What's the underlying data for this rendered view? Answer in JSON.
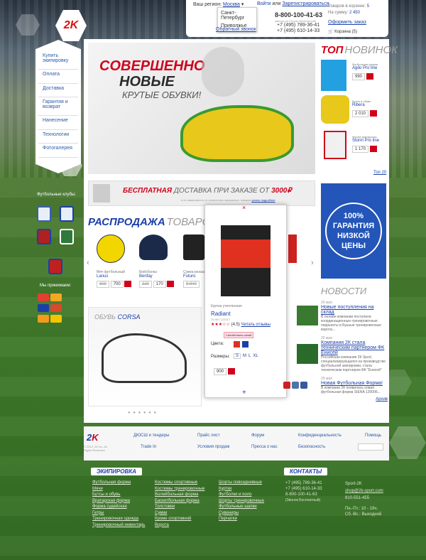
{
  "header": {
    "region_label": "Ваш регион:",
    "region_value": "Москва",
    "region_options": [
      "Санкт-Петербург",
      "Приволжье"
    ],
    "login": "Войти",
    "or": "или",
    "register": "Зарегистрироваться",
    "phone1": "8-800-100-41-63",
    "phone_note": "(звонок по России бесплатный)",
    "phone2": "+7 (495) 789-36-41",
    "phone3": "+7 (495) 610-14-33",
    "callback": "Обратный звонок",
    "cart_items_label": "Товаров в корзине:",
    "cart_items": "5",
    "cart_sum_label": "На сумму:",
    "cart_sum": "2 450",
    "checkout": "Оформить заказ",
    "cart_button": "Корзина (5)",
    "logo_text": "2K"
  },
  "nav": [
    "Купить экипировку",
    "Оплата",
    "Доставка",
    "Гарантия и возврат",
    "Нанесение",
    "Технологии",
    "Фотогалерея"
  ],
  "clubs_title": "Футбольные клубы:",
  "pay_title": "Мы принимаем:",
  "banner": {
    "line1": "СОВЕРШЕННО",
    "line2": "НОВЫЕ",
    "line3": "КРУТЫЕ ОБУВКИ!"
  },
  "delivery": {
    "strong": "БЕСПЛАТНАЯ",
    "rest": "ДОСТАВКА ПРИ ЗАКАЗЕ ОТ",
    "amount": "3000",
    "note": "и не зависимости от количества заказанных товаров",
    "link": "узнать подробнее"
  },
  "sale": {
    "title": "РАСПРОДАЖА",
    "title2": "ТОВАРОВ",
    "products": [
      {
        "cat": "Мяч футбольный",
        "name": "Lanus",
        "old": "800",
        "price": "700"
      },
      {
        "cat": "Бейсболка",
        "name": "Benfay",
        "old": "220",
        "price": "170"
      },
      {
        "cat": "Сумка-рюкзак",
        "name": "Futuro",
        "old": "9 940",
        "price": ""
      }
    ]
  },
  "popup": {
    "cat": "Куртка утепленная",
    "name": "Radiant",
    "sku": "29-987-123217",
    "rating": "(4.5)",
    "reviews": "Читать отзывы",
    "color_tip": "Синий/темно-синий",
    "colors_label": "Цвета:",
    "sizes_label": "Размеры:",
    "sizes": [
      "S",
      "M",
      "L",
      "XL"
    ],
    "price": "900"
  },
  "shoes": {
    "label": "ОБУВЬ",
    "brand": "CORSA"
  },
  "top": {
    "title": "ТОП",
    "title2": "НОВИНОК",
    "items": [
      {
        "cat": "Футбольная форма",
        "name": "Agilo Pro line",
        "price": "990"
      },
      {
        "cat": "Бутсы в обувь",
        "name": "Ribera",
        "price": "2 010"
      },
      {
        "cat": "Форма вратарская",
        "name": "Storm Pro line",
        "price": "1 170"
      }
    ],
    "link": "Топ 20"
  },
  "guarantee": {
    "line1": "100%",
    "line2": "ГАРАНТИЯ",
    "line3": "НИЗКОЙ",
    "line4": "ЦЕНЫ"
  },
  "news": {
    "title": "НОВОСТИ",
    "items": [
      {
        "date": "20 мая",
        "title": "Новые поступления на склад",
        "text": "В онлайн компании поступили координационные-тренировочные перрьекты и Буьные тренировочные ворота..."
      },
      {
        "date": "20 мая",
        "title": "Компания 2К стала техническим партнером ФК Енисей",
        "text": "Российская компания 2К Sport, специализирующаяся на производстве футбольной экипировки, стала техническим партнером ФК \"Енисей\""
      },
      {
        "date": "29 мая",
        "title": "Новая Футбольная Форма!",
        "text": "В компании 2К появилась новая футбольная форма SIENA 120006..."
      }
    ],
    "archive": "Архив"
  },
  "footer": {
    "copyright": "© 2012. 2K Inc. All Rights Reserved",
    "links": [
      "ДЮСШ и тендеры",
      "Прайс лист",
      "Форум",
      "Конфиденциальность",
      "Помощь",
      "Trade In",
      "Условия продаж",
      "Пресса о нас",
      "Безопасность"
    ]
  },
  "bottom": {
    "ekip_title": "ЭКИПИРОВКА",
    "col1": [
      "Футбольная форма",
      "Мячи",
      "Бутсы и обувь",
      "Вратарская форма",
      "Форма судейская",
      "Гетры",
      "Тренировочная одежда",
      "Тренировочный инвентарь"
    ],
    "col2": [
      "Костюмы спортивные",
      "Костюмы тренировочные",
      "Волейбольная форма",
      "Баскетбольная форма",
      "Толстовки",
      "Сумки",
      "Кроме спортивной",
      "Ворота"
    ],
    "col3": [
      "Шорты повседневные",
      "Куртки",
      "Футболки и поло",
      "Шорты тренировочные",
      "Футбольные шапки",
      "Сувениры",
      "Перчатки"
    ],
    "contacts_title": "КОНТАКТЫ",
    "phones": [
      "+7 (495) 789-36-41",
      "+7 (495) 610-14-33",
      "8-800-100-41-63",
      "(Звонок Бесплатный)"
    ],
    "skype": "Sport-2K",
    "email": "shop@2k-sport.com",
    "icq": "810-551-455",
    "hours": "Пн.-Пт.: 10 - 19ч.",
    "hours2": "Сб.-Вс.: Выходной"
  }
}
